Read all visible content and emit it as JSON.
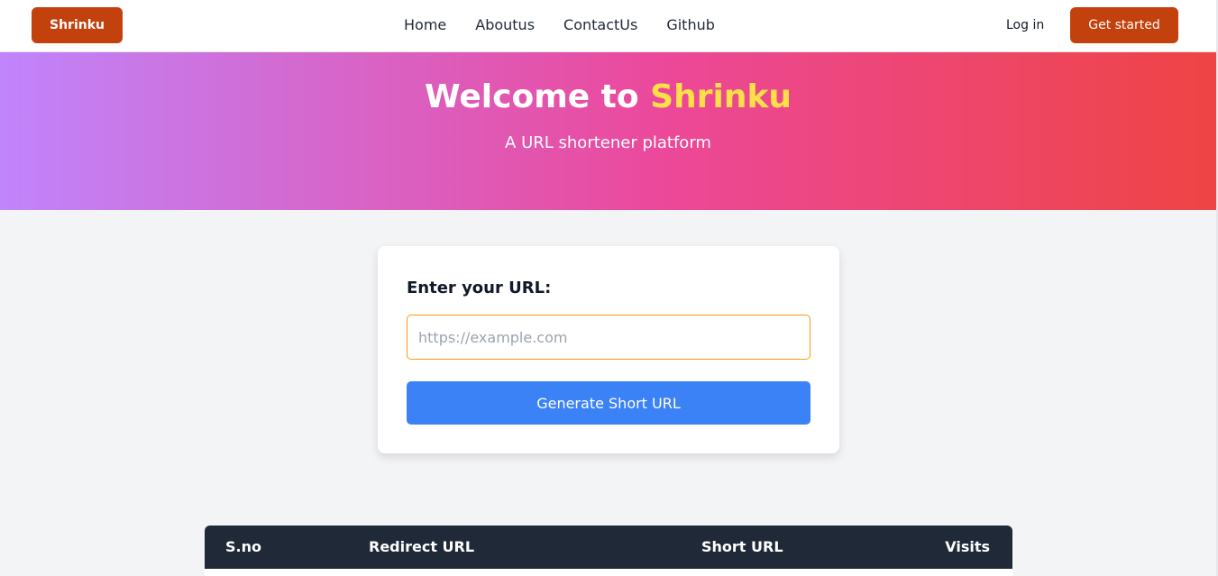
{
  "navbar": {
    "brand": "Shrinku",
    "links": [
      "Home",
      "Aboutus",
      "ContactUs",
      "Github"
    ],
    "login": "Log in",
    "get_started": "Get started"
  },
  "hero": {
    "title_prefix": "Welcome to",
    "title_accent": "Shrinku",
    "subtitle": "A URL shortener platform"
  },
  "form": {
    "label": "Enter your URL:",
    "placeholder": "https://example.com",
    "value": "",
    "button": "Generate Short URL"
  },
  "table": {
    "headers": [
      "S.no",
      "Redirect URL",
      "Short URL",
      "Visits"
    ]
  },
  "colors": {
    "brand": "#c2410c",
    "accent_yellow": "#fde047",
    "primary_blue": "#3b82f6",
    "table_header": "#1f2937",
    "input_border": "#f59e0b"
  }
}
